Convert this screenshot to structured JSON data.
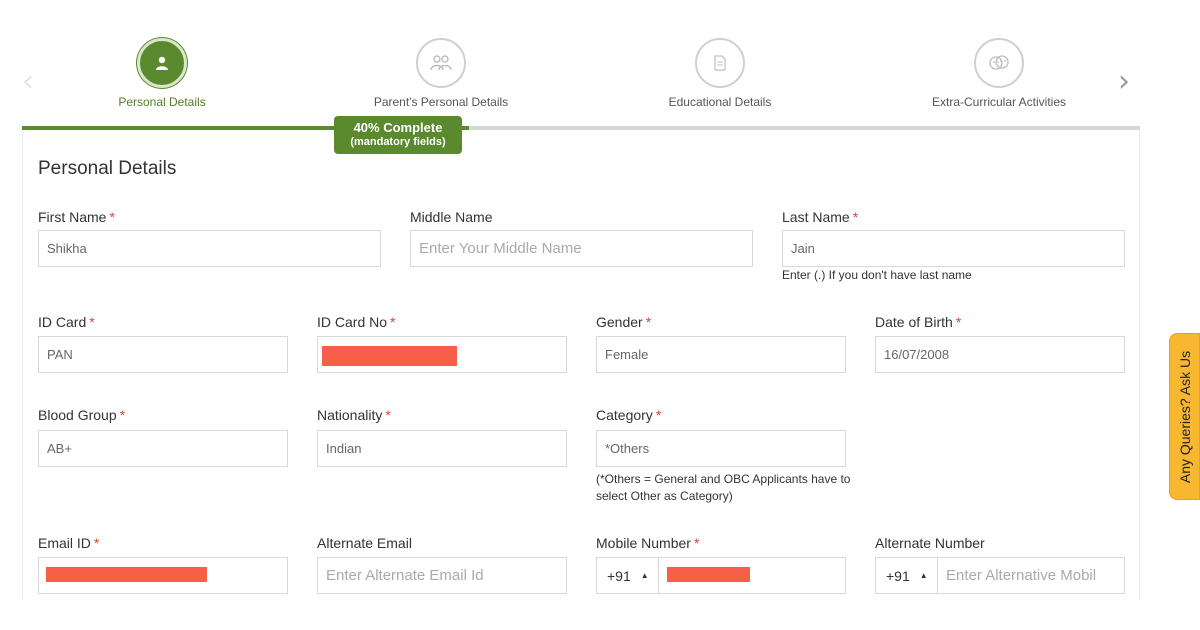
{
  "stepper": {
    "prev_icon": "chevron-left-icon",
    "next_icon": "chevron-right-icon",
    "steps": [
      {
        "label": "Personal Details",
        "icon": "user-icon",
        "active": true
      },
      {
        "label": "Parent's Personal Details",
        "icon": "parents-icon",
        "active": false
      },
      {
        "label": "Educational Details",
        "icon": "document-icon",
        "active": false
      },
      {
        "label": "Extra-Curricular Activities",
        "icon": "masks-icon",
        "active": false
      }
    ]
  },
  "progress": {
    "percent": 40,
    "label": "40% Complete",
    "sublabel": "(mandatory fields)",
    "colors": {
      "fill": "#5a8a2d",
      "track": "#d7d7d7"
    }
  },
  "section": {
    "title": "Personal Details"
  },
  "required_marker": "*",
  "fields": {
    "first_name": {
      "label": "First Name",
      "value": "Shikha",
      "required": true
    },
    "middle_name": {
      "label": "Middle Name",
      "placeholder": "Enter Your Middle Name",
      "required": false
    },
    "last_name": {
      "label": "Last Name",
      "value": "Jain",
      "required": true,
      "hint": "Enter (.) If you don't have last name"
    },
    "id_card": {
      "label": "ID Card",
      "value": "PAN",
      "required": true
    },
    "id_card_no": {
      "label": "ID Card No",
      "redacted": true,
      "required": true
    },
    "gender": {
      "label": "Gender",
      "value": "Female",
      "required": true
    },
    "dob": {
      "label": "Date of Birth",
      "value": "16/07/2008",
      "required": true
    },
    "blood_group": {
      "label": "Blood Group",
      "value": "AB+",
      "required": true
    },
    "nationality": {
      "label": "Nationality",
      "value": "Indian",
      "required": true
    },
    "category": {
      "label": "Category",
      "value": "*Others",
      "required": true,
      "hint": "(*Others = General and OBC Applicants have to select Other as Category)"
    },
    "email": {
      "label": "Email ID",
      "redacted": true,
      "required": true
    },
    "alt_email": {
      "label": "Alternate Email",
      "placeholder": "Enter Alternate Email Id",
      "required": false
    },
    "mobile": {
      "label": "Mobile Number",
      "country_code": "+91",
      "redacted": true,
      "required": true
    },
    "alt_number": {
      "label": "Alternate Number",
      "country_code": "+91",
      "placeholder": "Enter Alternative Mobil",
      "required": false
    }
  },
  "side_tab": {
    "label": "Any Queries? Ask Us",
    "color": "#f7b731"
  },
  "colors": {
    "accent": "#5a8a2d",
    "required": "#d9443a",
    "redaction": "#f85f48"
  }
}
